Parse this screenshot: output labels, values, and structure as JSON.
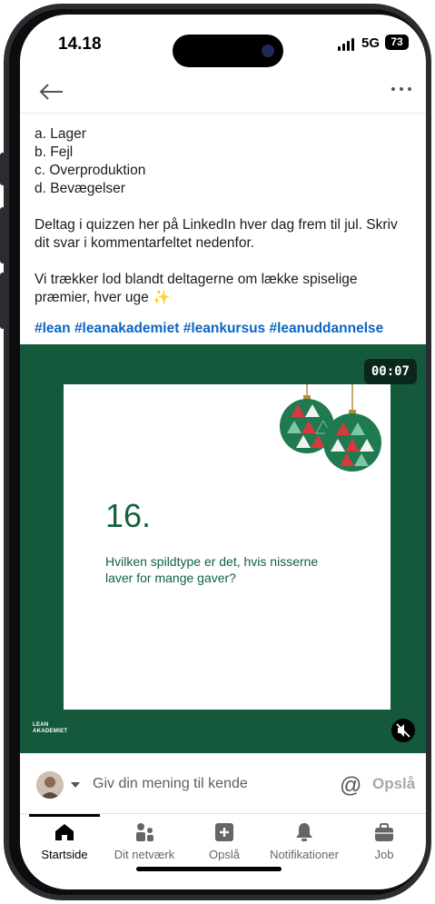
{
  "status_bar": {
    "time": "14.18",
    "network": "5G",
    "battery": "73"
  },
  "post": {
    "options": [
      "a. Lager",
      "b. Fejl",
      "c. Overproduktion",
      "d. Bevægelser"
    ],
    "paragraph_1": "Deltag i quizzen her på LinkedIn hver dag frem til jul. Skriv dit svar i kommentarfeltet nedenfor.",
    "paragraph_2": "Vi trækker lod blandt deltagerne om lække spiselige præmier, hver uge ✨",
    "hashtags": "#lean #leanakademiet #leankursus #leanuddannelse"
  },
  "video": {
    "duration": "00:07",
    "card_number": "16.",
    "card_question": "Hvilken spildtype er det, hvis nisserne laver for mange gaver?",
    "logo_text_1": "LEAN",
    "logo_text_2": "AKADEMIET"
  },
  "comment_bar": {
    "placeholder": "Giv din mening til kende",
    "post_label": "Opslå"
  },
  "tabs": [
    {
      "label": "Startside",
      "icon": "home-icon",
      "active": true
    },
    {
      "label": "Dit netværk",
      "icon": "network-icon",
      "active": false
    },
    {
      "label": "Opslå",
      "icon": "post-icon",
      "active": false
    },
    {
      "label": "Notifikationer",
      "icon": "bell-icon",
      "active": false
    },
    {
      "label": "Job",
      "icon": "briefcase-icon",
      "active": false
    }
  ],
  "colors": {
    "brand_green": "#15593d",
    "text_green": "#12623f",
    "link_blue": "#0a66c2",
    "ornament_red": "#d63a3f"
  }
}
